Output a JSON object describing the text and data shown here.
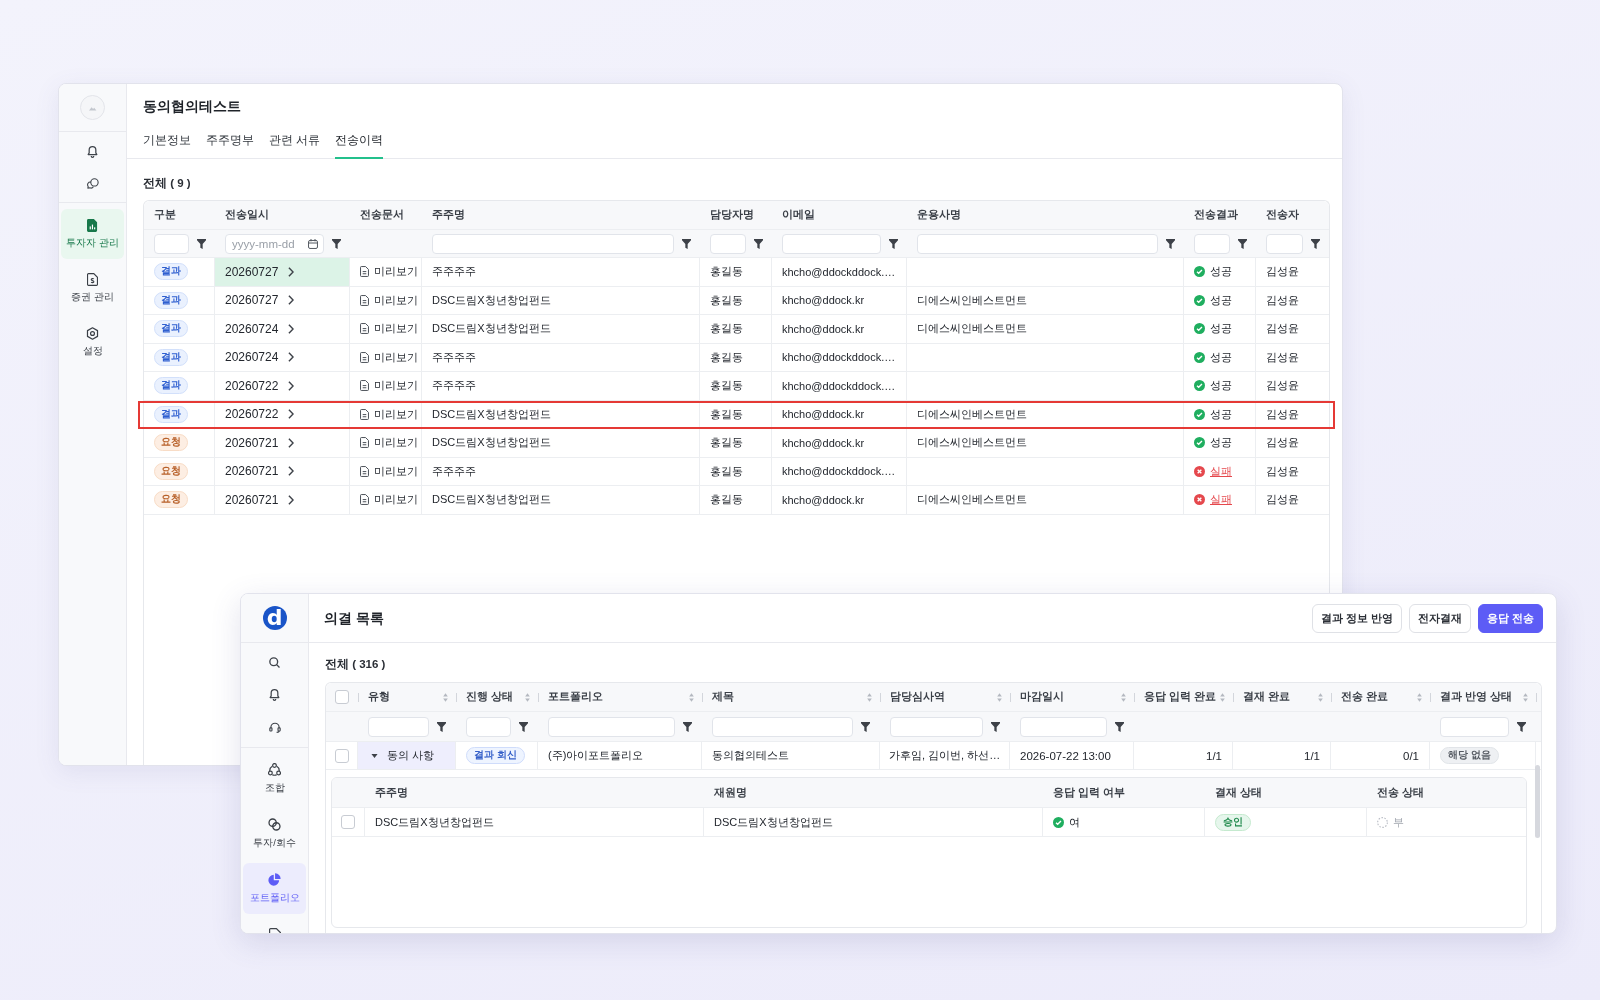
{
  "back_window": {
    "sidebar": {
      "items": [
        {
          "label": "투자자 관리",
          "selected": true
        },
        {
          "label": "증권 관리",
          "selected": false
        },
        {
          "label": "설정",
          "selected": false
        }
      ]
    },
    "title": "동의협의테스트",
    "tabs": [
      {
        "label": "기본정보",
        "selected": false
      },
      {
        "label": "주주명부",
        "selected": false
      },
      {
        "label": "관련 서류",
        "selected": false
      },
      {
        "label": "전송이력",
        "selected": true
      }
    ],
    "total": "전체 ( 9 )",
    "table": {
      "columns": [
        {
          "label": "구분",
          "kind": "text"
        },
        {
          "label": "전송일시",
          "kind": "date",
          "placeholder": "yyyy-mm-dd"
        },
        {
          "label": "전송문서",
          "kind": "plain"
        },
        {
          "label": "주주명",
          "kind": "text"
        },
        {
          "label": "담당자명",
          "kind": "text"
        },
        {
          "label": "이메일",
          "kind": "text"
        },
        {
          "label": "운용사명",
          "kind": "text"
        },
        {
          "label": "전송결과",
          "kind": "text"
        },
        {
          "label": "전송자",
          "kind": "text"
        }
      ],
      "rows": [
        {
          "type": {
            "kind": "result",
            "label": "결과"
          },
          "date": "20260727",
          "date_active": true,
          "document": "미리보기",
          "shareholder": "주주주주",
          "manager": "홍길동",
          "email": "khcho@ddockddock.…",
          "result": {
            "kind": "success",
            "label": "성공"
          },
          "sender": "김성윤",
          "highlighted": false
        },
        {
          "type": {
            "kind": "result",
            "label": "결과"
          },
          "date": "20260727",
          "date_active": false,
          "document": "미리보기",
          "shareholder": "DSC드림X청년창업펀드",
          "manager": "홍길동",
          "email": "khcho@ddock.kr",
          "fund_manager": "디에스씨인베스트먼트",
          "result": {
            "kind": "success",
            "label": "성공"
          },
          "sender": "김성윤",
          "highlighted": false
        },
        {
          "type": {
            "kind": "result",
            "label": "결과"
          },
          "date": "20260724",
          "date_active": false,
          "document": "미리보기",
          "shareholder": "DSC드림X청년창업펀드",
          "manager": "홍길동",
          "email": "khcho@ddock.kr",
          "fund_manager": "디에스씨인베스트먼트",
          "result": {
            "kind": "success",
            "label": "성공"
          },
          "sender": "김성윤",
          "highlighted": false
        },
        {
          "type": {
            "kind": "result",
            "label": "결과"
          },
          "date": "20260724",
          "date_active": false,
          "document": "미리보기",
          "shareholder": "주주주주",
          "manager": "홍길동",
          "email": "khcho@ddockddock.…",
          "result": {
            "kind": "success",
            "label": "성공"
          },
          "sender": "김성윤",
          "highlighted": false
        },
        {
          "type": {
            "kind": "result",
            "label": "결과"
          },
          "date": "20260722",
          "date_active": false,
          "document": "미리보기",
          "shareholder": "주주주주",
          "manager": "홍길동",
          "email": "khcho@ddockddock.…",
          "result": {
            "kind": "success",
            "label": "성공"
          },
          "sender": "김성윤",
          "highlighted": false
        },
        {
          "type": {
            "kind": "result",
            "label": "결과"
          },
          "date": "20260722",
          "date_active": false,
          "document": "미리보기",
          "shareholder": "DSC드림X청년창업펀드",
          "manager": "홍길동",
          "email": "khcho@ddock.kr",
          "fund_manager": "디에스씨인베스트먼트",
          "result": {
            "kind": "success",
            "label": "성공"
          },
          "sender": "김성윤",
          "highlighted": true
        },
        {
          "type": {
            "kind": "request",
            "label": "요청"
          },
          "date": "20260721",
          "date_active": false,
          "document": "미리보기",
          "shareholder": "DSC드림X청년창업펀드",
          "manager": "홍길동",
          "email": "khcho@ddock.kr",
          "fund_manager": "디에스씨인베스트먼트",
          "result": {
            "kind": "success",
            "label": "성공"
          },
          "sender": "김성윤",
          "highlighted": false
        },
        {
          "type": {
            "kind": "request",
            "label": "요청"
          },
          "date": "20260721",
          "date_active": false,
          "document": "미리보기",
          "shareholder": "주주주주",
          "manager": "홍길동",
          "email": "khcho@ddockddock.…",
          "result": {
            "kind": "fail",
            "label": "실패"
          },
          "sender": "김성윤",
          "highlighted": false
        },
        {
          "type": {
            "kind": "request",
            "label": "요청"
          },
          "date": "20260721",
          "date_active": false,
          "document": "미리보기",
          "shareholder": "DSC드림X청년창업펀드",
          "manager": "홍길동",
          "email": "khcho@ddock.kr",
          "fund_manager": "디에스씨인베스트먼트",
          "result": {
            "kind": "fail",
            "label": "실패"
          },
          "sender": "김성윤",
          "highlighted": false
        }
      ]
    }
  },
  "front_window": {
    "logo": "d",
    "sidebar": {
      "items": [
        {
          "label": "조합",
          "selected": false
        },
        {
          "label": "투자/회수",
          "selected": false
        },
        {
          "label": "포트폴리오",
          "selected": true
        }
      ]
    },
    "title": "의결 목록",
    "buttons": [
      {
        "label": "결과 정보 반영",
        "kind": "secondary"
      },
      {
        "label": "전자결재",
        "kind": "secondary"
      },
      {
        "label": "응답 전송",
        "kind": "primary"
      }
    ],
    "total": "전체 ( 316 )",
    "table": {
      "select_all_checked": false,
      "columns": [
        {
          "label": "유형",
          "kind": "text"
        },
        {
          "label": "진행 상태",
          "kind": "text"
        },
        {
          "label": "포트폴리오",
          "kind": "text"
        },
        {
          "label": "제목",
          "kind": "text"
        },
        {
          "label": "담당심사역",
          "kind": "text"
        },
        {
          "label": "마감일시",
          "kind": "text"
        },
        {
          "label": "응답 입력 완료",
          "kind": "plain"
        },
        {
          "label": "결재 완료",
          "kind": "plain"
        },
        {
          "label": "전송 완료",
          "kind": "plain"
        },
        {
          "label": "결과 반영 상태",
          "kind": "text"
        }
      ],
      "rows": [
        {
          "checked": false,
          "expanded": true,
          "type": "동의 사항",
          "status": "결과 회신",
          "portfolio": "(주)아이포트폴리오",
          "title": "동의협의테스트",
          "reviewers": "가후임, 김이번, 하선…",
          "deadline": "2026-07-22 13:00",
          "response_done": "1/1",
          "approval_done": "1/1",
          "sent_done": "0/1",
          "result_status": "해당 없음",
          "details": {
            "columns": [
              "주주명",
              "재원명",
              "응답 입력 여부",
              "결재 상태",
              "전송 상태"
            ],
            "rows": [
              {
                "checked": false,
                "shareholder": "DSC드림X청년창업펀드",
                "fund": "DSC드림X청년창업펀드",
                "response": {
                  "label": "여",
                  "done": true
                },
                "approval": "승인",
                "sending": {
                  "label": "부",
                  "done": false
                }
              }
            ]
          }
        }
      ]
    }
  }
}
